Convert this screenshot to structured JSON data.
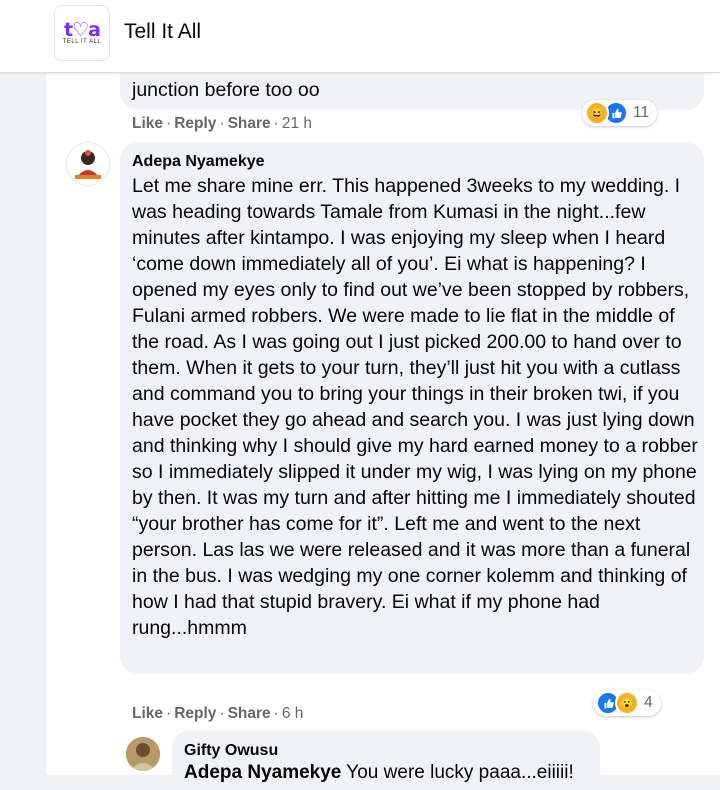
{
  "header": {
    "logo_mark": "t♡a",
    "logo_sub": "TELL IT ALL",
    "title": "Tell It All"
  },
  "prev_comment": {
    "text_tail": "junction before too oo",
    "actions": {
      "like": "Like",
      "reply": "Reply",
      "share": "Share",
      "time": "21 h"
    },
    "reactions": {
      "icons": [
        "haha-icon",
        "like-icon"
      ],
      "count": "11"
    }
  },
  "main_comment": {
    "author": "Adepa Nyamekye",
    "text": "Let me share mine err. This happened 3weeks to my wedding. I was heading towards Tamale from Kumasi in the night...few minutes after kintampo. I was enjoying my sleep when I heard ‘come down immediately all of you’. Ei what is happening? I opened my eyes only to find out we’ve been stopped by robbers, Fulani armed robbers. We were made to lie flat in the middle of the road. As I was going out I just picked 200.00 to hand over to them. When it gets to your turn, they’ll just hit you with a cutlass and command you to bring your things in their broken twi, if you have pocket they go ahead and search you. I was just lying down and thinking why I should give my hard earned money to a robber so I immediately slipped it under my wig, I was lying on my phone by then. It was my turn and after hitting me I immediately shouted “your brother has come for it”. Left me and went to the next person. Las las we were released and it was more than a funeral in the bus. I was wedging my one corner kolemm and thinking of how I had that stupid bravery. Ei what if my phone had rung...hmmm",
    "actions": {
      "like": "Like",
      "reply": "Reply",
      "share": "Share",
      "time": "6 h"
    },
    "reactions": {
      "icons": [
        "like-icon",
        "wow-icon"
      ],
      "count": "4"
    }
  },
  "reply": {
    "author": "Gifty Owusu",
    "mention": "Adepa Nyamekye",
    "text": " You were lucky paaa...eiiiii!"
  },
  "colors": {
    "bubble": "#f0f2f5",
    "meta": "#65676b",
    "like_blue": "#1877f2",
    "haha_yellow": "#f7b125"
  }
}
